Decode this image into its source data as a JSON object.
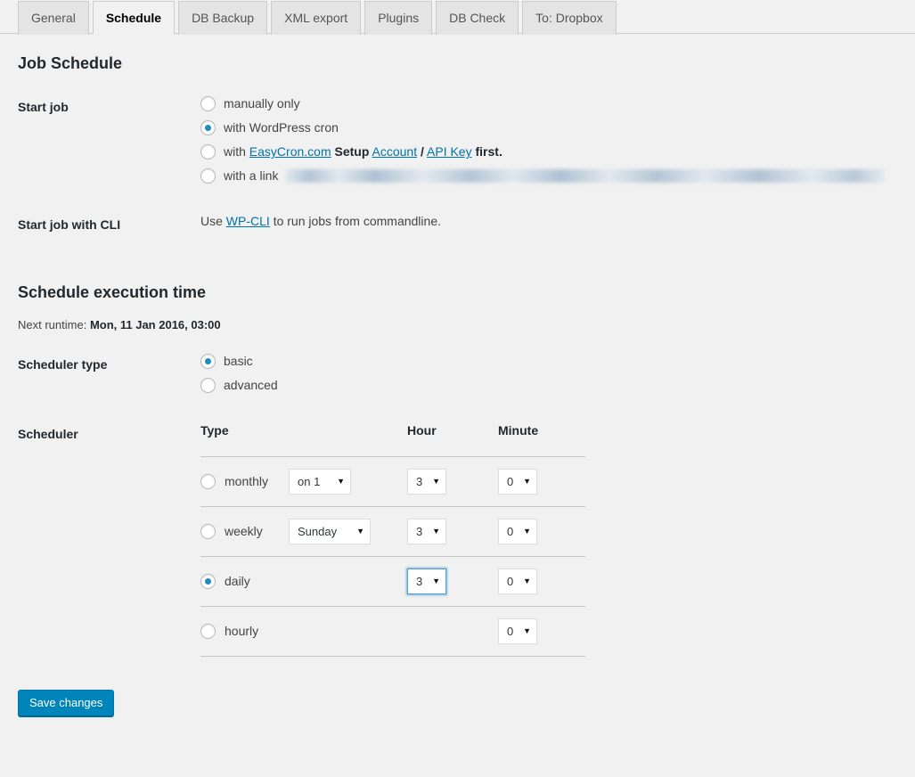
{
  "tabs": [
    {
      "label": "General",
      "active": false
    },
    {
      "label": "Schedule",
      "active": true
    },
    {
      "label": "DB Backup",
      "active": false
    },
    {
      "label": "XML export",
      "active": false
    },
    {
      "label": "Plugins",
      "active": false
    },
    {
      "label": "DB Check",
      "active": false
    },
    {
      "label": "To: Dropbox",
      "active": false
    }
  ],
  "job_schedule": {
    "title": "Job Schedule",
    "start_job_label": "Start job",
    "options": {
      "manual": "manually only",
      "wpcron": "with WordPress cron",
      "easycron_prefix": "with",
      "easycron_link": "EasyCron.com",
      "easycron_setup": "Setup",
      "easycron_account_link": "Account",
      "easycron_separator": "/",
      "easycron_apikey_link": "API Key",
      "easycron_suffix": "first.",
      "link": "with a link",
      "link_url_redacted": true
    },
    "selected_start": "wpcron",
    "cli_label": "Start job with CLI",
    "cli_text_prefix": "Use",
    "cli_link": "WP-CLI",
    "cli_text_suffix": "to run jobs from commandline."
  },
  "execution": {
    "title": "Schedule execution time",
    "next_runtime_label": "Next runtime:",
    "next_runtime_value": "Mon, 11 Jan 2016, 03:00",
    "scheduler_type_label": "Scheduler type",
    "type_basic": "basic",
    "type_advanced": "advanced",
    "selected_type": "basic"
  },
  "scheduler": {
    "label": "Scheduler",
    "headers": {
      "type": "Type",
      "hour": "Hour",
      "minute": "Minute"
    },
    "rows": [
      {
        "name": "monthly",
        "selected": false,
        "day_value": "on 1",
        "day_width": "w-on1",
        "hour_value": "3",
        "hour_focused": false,
        "minute_value": "0"
      },
      {
        "name": "weekly",
        "selected": false,
        "day_value": "Sunday",
        "day_width": "w-day",
        "hour_value": "3",
        "hour_focused": false,
        "minute_value": "0"
      },
      {
        "name": "daily",
        "selected": true,
        "day_value": null,
        "day_width": "",
        "hour_value": "3",
        "hour_focused": true,
        "minute_value": "0"
      },
      {
        "name": "hourly",
        "selected": false,
        "day_value": null,
        "day_width": "",
        "hour_value": null,
        "hour_focused": false,
        "minute_value": "0"
      }
    ],
    "select_arrow_icon": "caret-down-icon"
  },
  "footer": {
    "save_label": "Save changes"
  },
  "colors": {
    "page_background": "#f1f1f1",
    "accent_blue": "#0085ba",
    "link_blue": "#0073aa",
    "radio_dot": "#1e8cbe",
    "focus_border": "#5b9dd9",
    "heading": "#23282d",
    "rule": "#c6c6c6"
  }
}
